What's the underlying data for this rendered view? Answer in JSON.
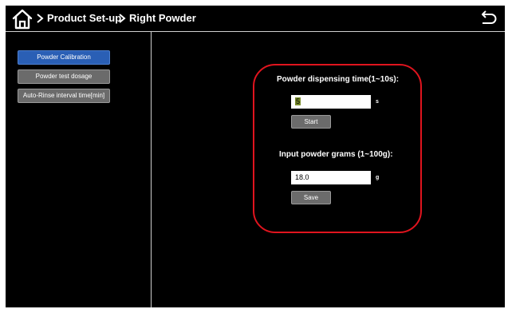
{
  "header": {
    "crumb1": "Product Set-up",
    "crumb2": "Right Powder"
  },
  "sidebar": {
    "items": [
      {
        "label": "Powder Calibration",
        "active": true
      },
      {
        "label": "Powder test dosage",
        "active": false
      },
      {
        "label": "Auto-Rinse interval time[min]",
        "active": false
      }
    ]
  },
  "panel": {
    "time_label": "Powder dispensing time(1~10s):",
    "time_value": "5",
    "time_unit": "s",
    "start_label": "Start",
    "grams_label": "Input powder grams (1~100g):",
    "grams_value": "18.0",
    "grams_unit": "g",
    "save_label": "Save"
  },
  "colors": {
    "accent_blue": "#2a5fb5",
    "highlight_border": "#e0141e",
    "button_gray": "#6b6b6b"
  },
  "icons": [
    "home-icon",
    "chevron-right-icon",
    "back-icon"
  ]
}
